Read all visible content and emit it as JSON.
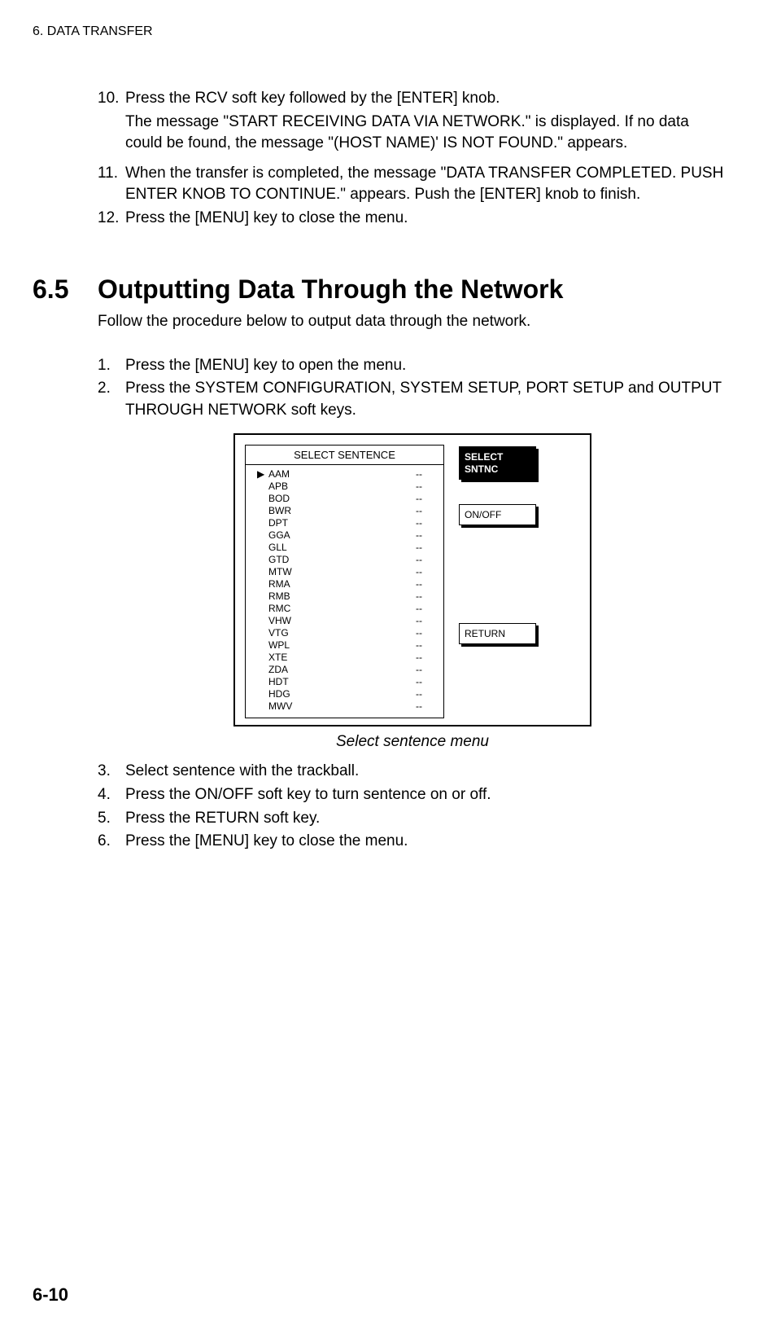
{
  "header": "6. DATA TRANSFER",
  "steps_top": [
    {
      "num": "10.",
      "text": "Press the RCV soft key followed by the [ENTER] knob."
    },
    {
      "indent": true,
      "text": "The message \"START RECEIVING DATA VIA NETWORK.\" is displayed. If no data could be found, the message \"(HOST NAME)' IS NOT FOUND.\" appears."
    },
    {
      "num": "11.",
      "text": "When the transfer is completed, the message \"DATA TRANSFER COMPLETED. PUSH ENTER KNOB TO CONTINUE.\" appears. Push the [ENTER] knob to finish."
    },
    {
      "num": "12.",
      "text": "Press the [MENU] key to close the menu."
    }
  ],
  "section": {
    "number": "6.5",
    "title": "Outputting Data Through the Network",
    "intro": "Follow the procedure below to output data through the network."
  },
  "steps_mid": [
    {
      "num": "1.",
      "text": "Press the [MENU] key to open the menu."
    },
    {
      "num": "2.",
      "text": "Press the SYSTEM CONFIGURATION, SYSTEM SETUP, PORT SETUP and OUTPUT THROUGH NETWORK soft keys."
    }
  ],
  "figure": {
    "list_title": "SELECT SENTENCE",
    "rows": [
      {
        "marker": "▶",
        "name": "AAM",
        "val": "--"
      },
      {
        "marker": "",
        "name": "APB",
        "val": "--"
      },
      {
        "marker": "",
        "name": "BOD",
        "val": "--"
      },
      {
        "marker": "",
        "name": "BWR",
        "val": "--"
      },
      {
        "marker": "",
        "name": "DPT",
        "val": "--"
      },
      {
        "marker": "",
        "name": "GGA",
        "val": "--"
      },
      {
        "marker": "",
        "name": "GLL",
        "val": "--"
      },
      {
        "marker": "",
        "name": "GTD",
        "val": "--"
      },
      {
        "marker": "",
        "name": "MTW",
        "val": "--"
      },
      {
        "marker": "",
        "name": "RMA",
        "val": "--"
      },
      {
        "marker": "",
        "name": "RMB",
        "val": "--"
      },
      {
        "marker": "",
        "name": "RMC",
        "val": "--"
      },
      {
        "marker": "",
        "name": "VHW",
        "val": "--"
      },
      {
        "marker": "",
        "name": "VTG",
        "val": "--"
      },
      {
        "marker": "",
        "name": "WPL",
        "val": "--"
      },
      {
        "marker": "",
        "name": "XTE",
        "val": "--"
      },
      {
        "marker": "",
        "name": "ZDA",
        "val": "--"
      },
      {
        "marker": "",
        "name": "HDT",
        "val": "--"
      },
      {
        "marker": "",
        "name": "HDG",
        "val": "--"
      },
      {
        "marker": "",
        "name": "MWV",
        "val": "--"
      }
    ],
    "softkeys": {
      "select": "SELECT\nSNTNC",
      "onoff": "ON/OFF",
      "ret": "RETURN"
    },
    "caption": "Select sentence menu"
  },
  "steps_bottom": [
    {
      "num": "3.",
      "text": "Select sentence with the trackball."
    },
    {
      "num": "4.",
      "text": "Press the ON/OFF soft key to turn sentence on or off."
    },
    {
      "num": "5.",
      "text": "Press the RETURN soft key."
    },
    {
      "num": "6.",
      "text": "Press the [MENU] key to close the menu."
    }
  ],
  "page_number": "6-10"
}
